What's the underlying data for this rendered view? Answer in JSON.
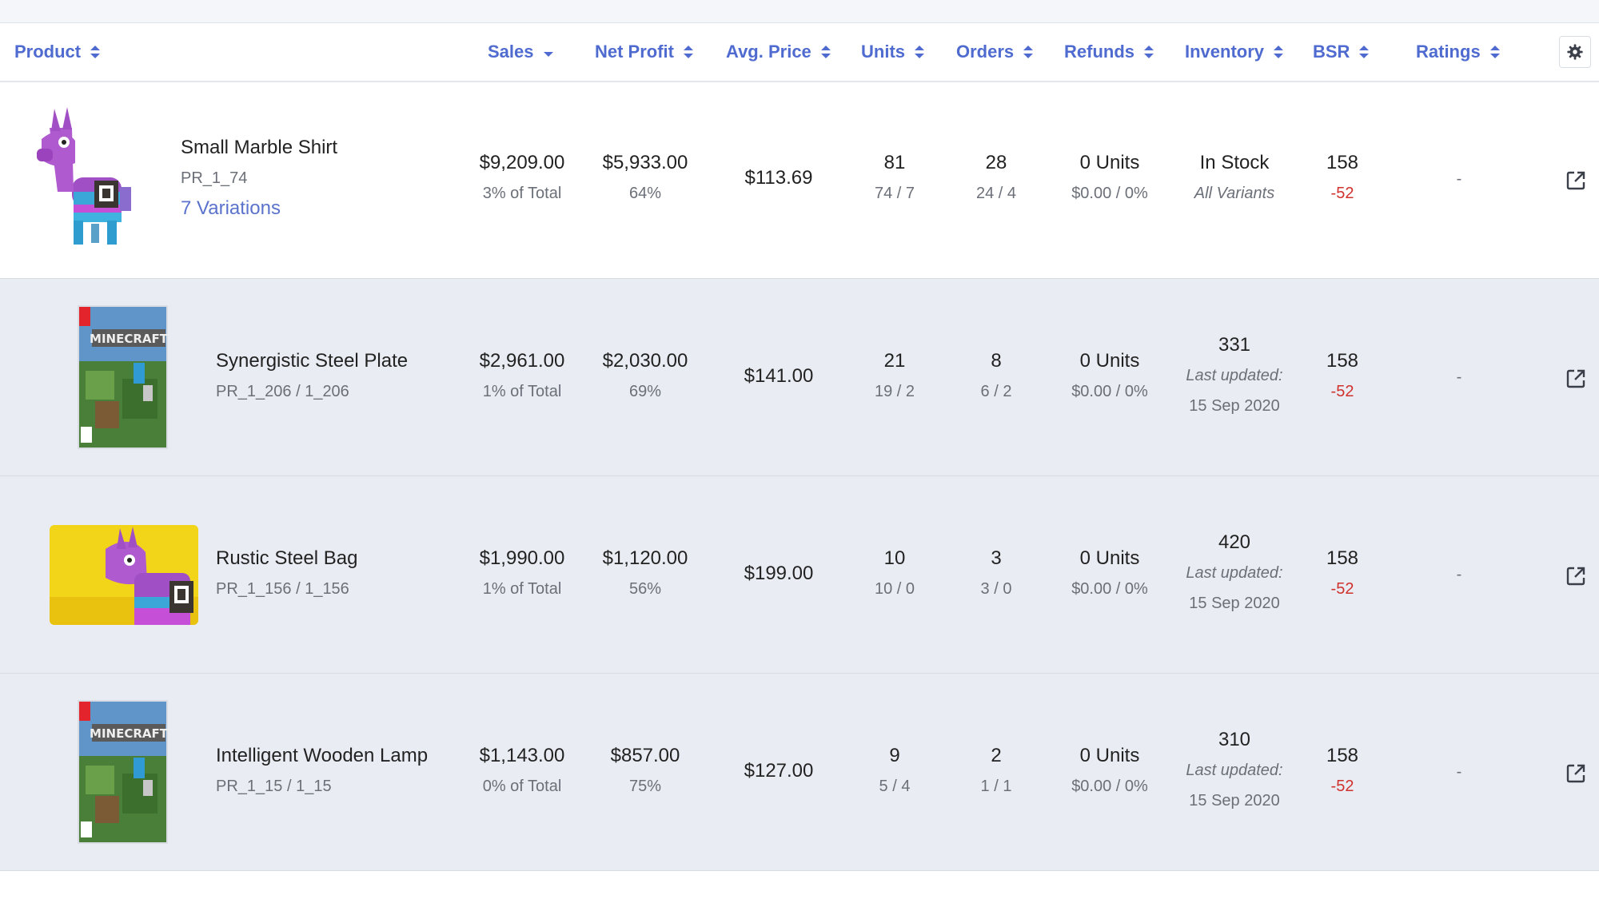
{
  "columns": {
    "product": "Product",
    "sales": "Sales",
    "net_profit": "Net Profit",
    "avg_price": "Avg. Price",
    "units": "Units",
    "orders": "Orders",
    "refunds": "Refunds",
    "inventory": "Inventory",
    "bsr": "BSR",
    "ratings": "Ratings"
  },
  "rows": [
    {
      "name": "Small Marble Shirt",
      "sku": "PR_1_74",
      "variations": "7 Variations",
      "sales": "$9,209.00",
      "sales_sub": "3% of Total",
      "net_profit": "$5,933.00",
      "net_profit_sub": "64%",
      "avg_price": "$113.69",
      "units": "81",
      "units_sub": "74 / 7",
      "orders": "28",
      "orders_sub": "24 / 4",
      "refunds": "0 Units",
      "refunds_sub": "$0.00 / 0%",
      "inventory": "In Stock",
      "inventory_sub": "All Variants",
      "bsr": "158",
      "bsr_change": "-52",
      "ratings": "-",
      "image": "llama-plush"
    },
    {
      "name": "Synergistic Steel Plate",
      "sku": "PR_1_206 / 1_206",
      "sales": "$2,961.00",
      "sales_sub": "1% of Total",
      "net_profit": "$2,030.00",
      "net_profit_sub": "69%",
      "avg_price": "$141.00",
      "units": "21",
      "units_sub": "19 / 2",
      "orders": "8",
      "orders_sub": "6 / 2",
      "refunds": "0 Units",
      "refunds_sub": "$0.00 / 0%",
      "inventory": "331",
      "inventory_label": "Last updated:",
      "inventory_date": "15 Sep 2020",
      "bsr": "158",
      "bsr_change": "-52",
      "ratings": "-",
      "image": "minecraft-box"
    },
    {
      "name": "Rustic Steel Bag",
      "sku": "PR_1_156 / 1_156",
      "sales": "$1,990.00",
      "sales_sub": "1% of Total",
      "net_profit": "$1,120.00",
      "net_profit_sub": "56%",
      "avg_price": "$199.00",
      "units": "10",
      "units_sub": "10 / 0",
      "orders": "3",
      "orders_sub": "3 / 0",
      "refunds": "0 Units",
      "refunds_sub": "$0.00 / 0%",
      "inventory": "420",
      "inventory_label": "Last updated:",
      "inventory_date": "15 Sep 2020",
      "bsr": "158",
      "bsr_change": "-52",
      "ratings": "-",
      "image": "llama-yellow"
    },
    {
      "name": "Intelligent Wooden Lamp",
      "sku": "PR_1_15 / 1_15",
      "sales": "$1,143.00",
      "sales_sub": "0% of Total",
      "net_profit": "$857.00",
      "net_profit_sub": "75%",
      "avg_price": "$127.00",
      "units": "9",
      "units_sub": "5 / 4",
      "orders": "2",
      "orders_sub": "1 / 1",
      "refunds": "0 Units",
      "refunds_sub": "$0.00 / 0%",
      "inventory": "310",
      "inventory_label": "Last updated:",
      "inventory_date": "15 Sep 2020",
      "bsr": "158",
      "bsr_change": "-52",
      "ratings": "-",
      "image": "minecraft-box"
    }
  ],
  "icons": {
    "settings": "gear-icon",
    "open": "external-link-icon",
    "sort": "sort-icon"
  },
  "colors": {
    "header_text": "#4f6bd0",
    "negative": "#d0312d",
    "row_alt_bg": "#e9edf3",
    "variations_link": "#5b73cc"
  }
}
